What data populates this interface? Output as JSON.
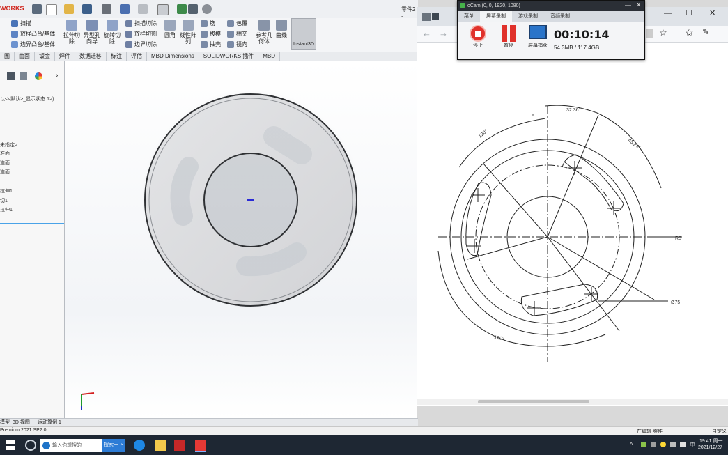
{
  "solidworks": {
    "logo": "WORKS",
    "doc_title": "零件2 -",
    "ribbon": {
      "sweep": "扫描",
      "loft_boss": "放样凸台/基体",
      "boundary_boss": "边界凸台/基体",
      "extruded_cut": "拉伸切除",
      "hole_wizard": "异型孔向导",
      "revolved_cut": "旋转切除",
      "swept_cut": "扫描切除",
      "lofted_cut": "放样切割",
      "boundary_cut": "边界切除",
      "fillet": "圆角",
      "linear_pattern": "线性阵列",
      "rib": "筋",
      "draft": "拔模",
      "shell": "抽壳",
      "wrap": "包覆",
      "intersect": "相交",
      "mirror": "镜向",
      "ref_geometry": "参考几何体",
      "curves": "曲线",
      "instant3d": "Instant3D"
    },
    "tabs": [
      "图",
      "曲面",
      "钣金",
      "焊件",
      "数据迁移",
      "标注",
      "评估",
      "MBD Dimensions",
      "SOLIDWORKS 插件",
      "MBD"
    ],
    "feature_tree": {
      "config": "认<<默认>_显示状态 1>)",
      "unspecified": "未指定>",
      "plane1": "准面",
      "plane2": "准面",
      "plane3": "准面",
      "extrude1": "拉伸1",
      "cut1": "切1",
      "extrude2": "拉伸1"
    },
    "bottom_tabs": [
      "模型",
      "3D 视图",
      "运动算例 1"
    ],
    "version": "Premium 2021 SP2.0",
    "status_editing": "在编辑 零件",
    "status_custom": "自定义"
  },
  "ocam": {
    "title": "oCam (0, 0, 1920, 1080)",
    "tabs": [
      "菜单",
      "屏幕录制",
      "游戏录制",
      "音频录制"
    ],
    "stop": "停止",
    "pause": "暂停",
    "capture": "屏幕捕获",
    "timer": "00:10:14",
    "size": "54.3MB / 117.4GB"
  },
  "drawing": {
    "dim_top_angle": "32.36°",
    "dim_right_angle": "45.24°",
    "dim_left_angle": "120°",
    "dim_bottom_angle": "120°",
    "dim_r": "R8",
    "dim_dia": "Ø75",
    "label_a": "A"
  },
  "taskbar": {
    "search_placeholder": "输入你想搜的",
    "search_button": "搜索一下",
    "clock_time": "19:41 周一",
    "clock_date": "2021/12/27",
    "ime": "中"
  },
  "colors": {
    "accent": "#d0261d",
    "taskbar": "#1e2733",
    "ocam_stop": "#e0312b"
  }
}
